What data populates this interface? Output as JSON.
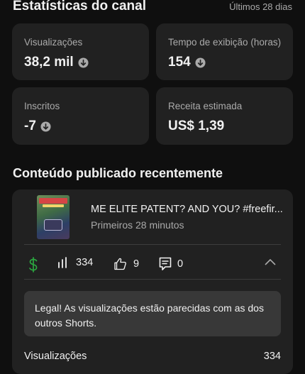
{
  "header": {
    "title": "Estatísticas do canal",
    "range": "Últimos 28 dias"
  },
  "stats": [
    {
      "label": "Visualizações",
      "value": "38,2 mil"
    },
    {
      "label": "Tempo de exibição (horas)",
      "value": "154"
    },
    {
      "label": "Inscritos",
      "value": "-7"
    },
    {
      "label": "Receita estimada",
      "value": "US$ 1,39"
    }
  ],
  "section": {
    "title": "Conteúdo publicado recentemente"
  },
  "video": {
    "title": "ME ELITE PATENT? AND YOU? #freefir...",
    "subtitle": "Primeiros 28 minutos",
    "views": "334",
    "likes": "9",
    "comments": "0"
  },
  "tip": {
    "text": "Legal! As visualizações estão parecidas com as dos outros Shorts."
  },
  "detail_row": {
    "label": "Visualizações",
    "value": "334"
  },
  "colors": {
    "background": "#0f0f0f",
    "card": "#212121",
    "monetization_green": "#2ba640"
  }
}
